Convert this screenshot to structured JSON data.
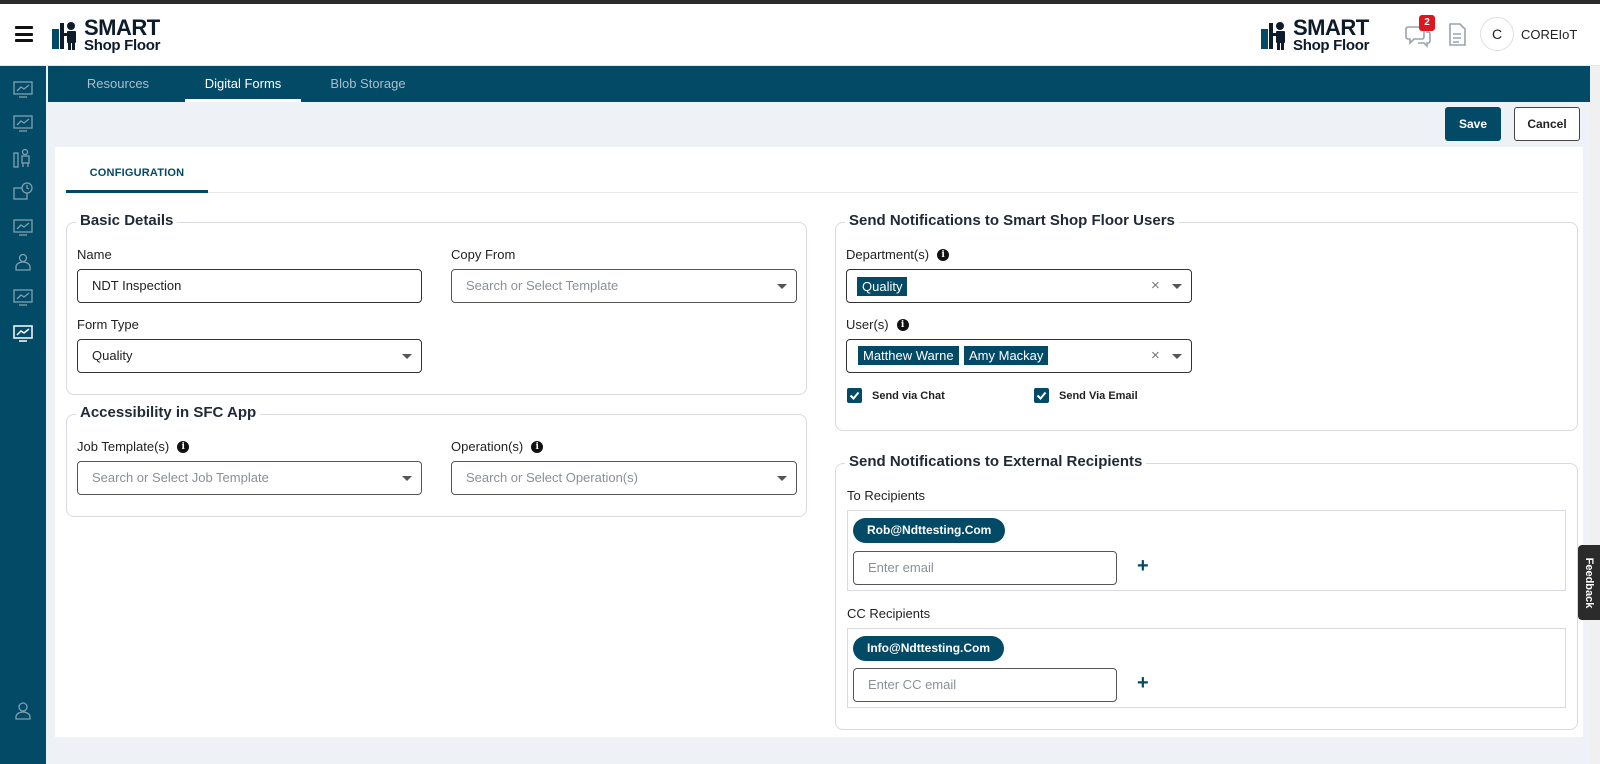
{
  "header": {
    "logo_line1": "SMART",
    "logo_line2": "Shop Floor",
    "notification_count": "2",
    "avatar_initial": "C",
    "username": "COREIoT"
  },
  "nav_tabs": [
    {
      "label": "Resources",
      "active": false
    },
    {
      "label": "Digital Forms",
      "active": true
    },
    {
      "label": "Blob Storage",
      "active": false
    }
  ],
  "actions": {
    "save_label": "Save",
    "cancel_label": "Cancel"
  },
  "config_tab": "CONFIGURATION",
  "basic_details": {
    "title": "Basic Details",
    "name_label": "Name",
    "name_value": "NDT Inspection",
    "copy_from_label": "Copy From",
    "copy_from_placeholder": "Search or Select Template",
    "form_type_label": "Form Type",
    "form_type_value": "Quality"
  },
  "accessibility": {
    "title": "Accessibility in SFC App",
    "job_template_label": "Job Template(s)",
    "job_template_placeholder": "Search or Select Job Template",
    "operation_label": "Operation(s)",
    "operation_placeholder": "Search or Select Operation(s)"
  },
  "sfu_notifications": {
    "title": "Send Notifications to Smart Shop Floor Users",
    "department_label": "Department(s)",
    "departments": [
      "Quality"
    ],
    "users_label": "User(s)",
    "users": [
      "Matthew Warne",
      "Amy Mackay"
    ],
    "send_chat_label": "Send via Chat",
    "send_chat_checked": true,
    "send_email_label": "Send Via Email",
    "send_email_checked": true
  },
  "external": {
    "title": "Send Notifications to External Recipients",
    "to_label": "To Recipients",
    "to_emails": [
      "Rob@Ndttesting.Com"
    ],
    "to_placeholder": "Enter email",
    "cc_label": "CC Recipients",
    "cc_emails": [
      "Info@Ndttesting.Com"
    ],
    "cc_placeholder": "Enter CC email"
  },
  "feedback_label": "Feedback",
  "colors": {
    "primary": "#034a67",
    "badge": "#e0161e"
  }
}
